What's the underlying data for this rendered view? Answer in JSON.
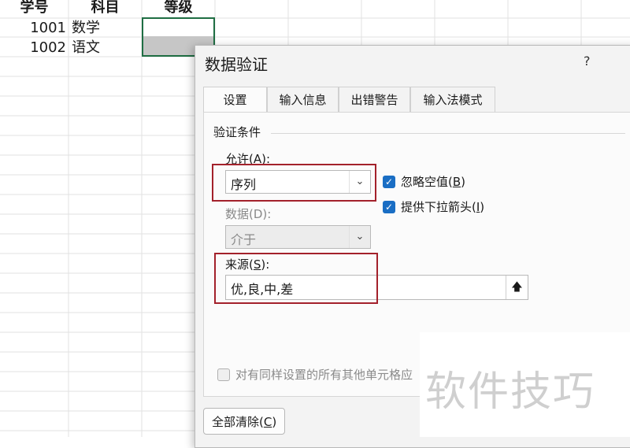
{
  "sheet": {
    "headers": [
      "学号",
      "科目",
      "等级"
    ],
    "rows": [
      {
        "id": "1001",
        "subject": "数学",
        "grade": ""
      },
      {
        "id": "1002",
        "subject": "语文",
        "grade": ""
      }
    ]
  },
  "dialog": {
    "title": "数据验证",
    "help": "?",
    "tabs": [
      "设置",
      "输入信息",
      "出错警告",
      "输入法模式"
    ],
    "section_label": "验证条件",
    "allow": {
      "label": "允许(",
      "key": "A",
      "label_end": "):",
      "value": "序列"
    },
    "data": {
      "label": "数据(D):",
      "value": "介于"
    },
    "ignore_blank": {
      "label": "忽略空值(",
      "key": "B",
      "label_end": ")",
      "checked": true
    },
    "dropdown": {
      "label": "提供下拉箭头(",
      "key": "I",
      "label_end": ")",
      "checked": true
    },
    "source": {
      "label": "来源(",
      "key": "S",
      "label_end": "):",
      "value": "优,良,中,差"
    },
    "apply_all": {
      "label": "对有同样设置的所有其他单元格应",
      "checked": false
    },
    "clear_button": {
      "label": "全部清除(",
      "key": "C",
      "label_end": ")"
    }
  },
  "watermark": "软件技巧",
  "colors": {
    "highlight": "#a3212b",
    "checkbox": "#1a6ec4",
    "selection": "#1f6e43"
  }
}
